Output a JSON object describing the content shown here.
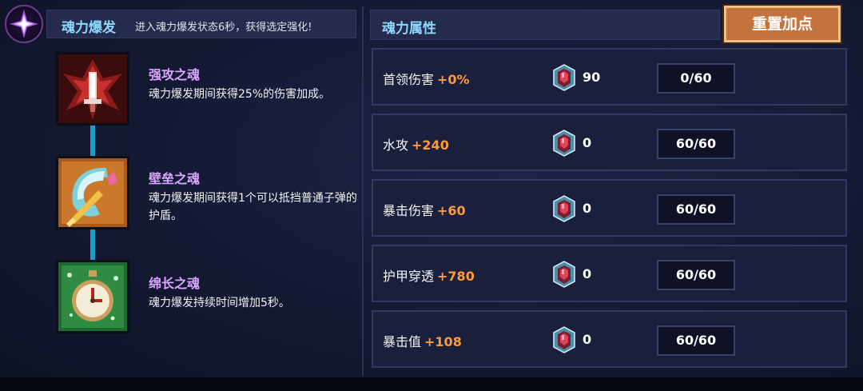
{
  "left_panel": {
    "title": "魂力爆发",
    "description": "进入魂力爆发状态6秒，获得选定强化!",
    "souls": [
      {
        "name": "强攻之魂",
        "description": "魂力爆发期间获得25%的伤害加成。",
        "icon": "red-claw-dagger-icon"
      },
      {
        "name": "壁垒之魂",
        "description": "魂力爆发期间获得1个可以抵挡普通子弹的护盾。",
        "icon": "shield-icon"
      },
      {
        "name": "绵长之魂",
        "description": "魂力爆发持续时间增加5秒。",
        "icon": "stopwatch-icon"
      }
    ]
  },
  "right_panel": {
    "title": "魂力属性",
    "reset_label": "重置加点",
    "attributes": [
      {
        "name": "首领伤害",
        "bonus": "+0%",
        "gems": "90",
        "points": "0/60"
      },
      {
        "name": "水攻",
        "bonus": "+240",
        "gems": "0",
        "points": "60/60"
      },
      {
        "name": "暴击伤害",
        "bonus": "+60",
        "gems": "0",
        "points": "60/60"
      },
      {
        "name": "护甲穿透",
        "bonus": "+780",
        "gems": "0",
        "points": "60/60"
      },
      {
        "name": "暴击值",
        "bonus": "+108",
        "gems": "0",
        "points": "60/60"
      }
    ]
  },
  "colors": {
    "title_blue": "#8fd7ff",
    "soul_name_purple": "#d9a6ff",
    "bonus_orange": "#ff9a3a",
    "reset_button": "#c4733c"
  }
}
